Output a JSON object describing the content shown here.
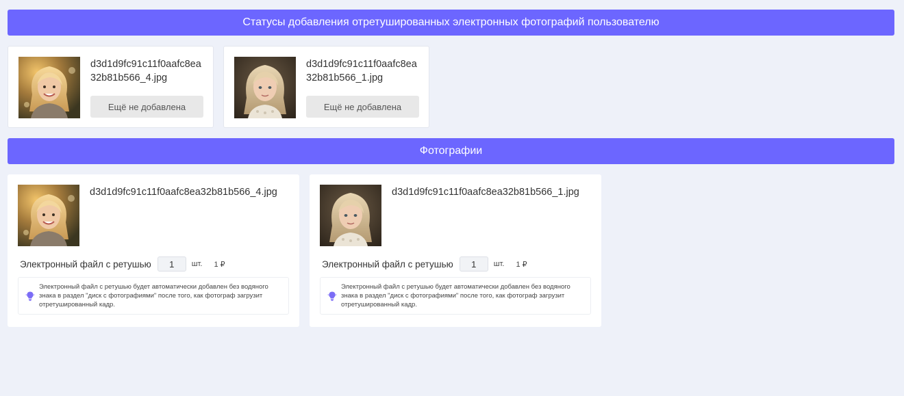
{
  "status_section": {
    "title": "Статусы добавления отретушированных электронных фотографий пользователю",
    "cards": [
      {
        "filename": "d3d1d9fc91c11f0aafc8ea32b81b566_4.jpg",
        "status": "Ещё не добавлена"
      },
      {
        "filename": "d3d1d9fc91c11f0aafc8ea32b81b566_1.jpg",
        "status": "Ещё не добавлена"
      }
    ]
  },
  "photos_section": {
    "title": "Фотографии",
    "cards": [
      {
        "filename": "d3d1d9fc91c11f0aafc8ea32b81b566_4.jpg",
        "product_label": "Электронный файл с ретушью",
        "quantity": "1",
        "unit": "шт.",
        "price": "1 ₽",
        "note": "Электронный файл с ретушью будет автоматически добавлен без водяного знака в раздел \"диск с фотографиями\" после того, как фотограф загрузит отретушированный кадр."
      },
      {
        "filename": "d3d1d9fc91c11f0aafc8ea32b81b566_1.jpg",
        "product_label": "Электронный файл с ретушью",
        "quantity": "1",
        "unit": "шт.",
        "price": "1 ₽",
        "note": "Электронный файл с ретушью будет автоматически добавлен без водяного знака в раздел \"диск с фотографиями\" после того, как фотограф загрузит отретушированный кадр."
      }
    ]
  },
  "colors": {
    "accent": "#6c66ff",
    "background": "#eef1f9",
    "status_button": "#e8e8e8"
  },
  "icons": {
    "photo_thumbnail": "photo-thumbnail",
    "note": "lightbulb-icon"
  }
}
